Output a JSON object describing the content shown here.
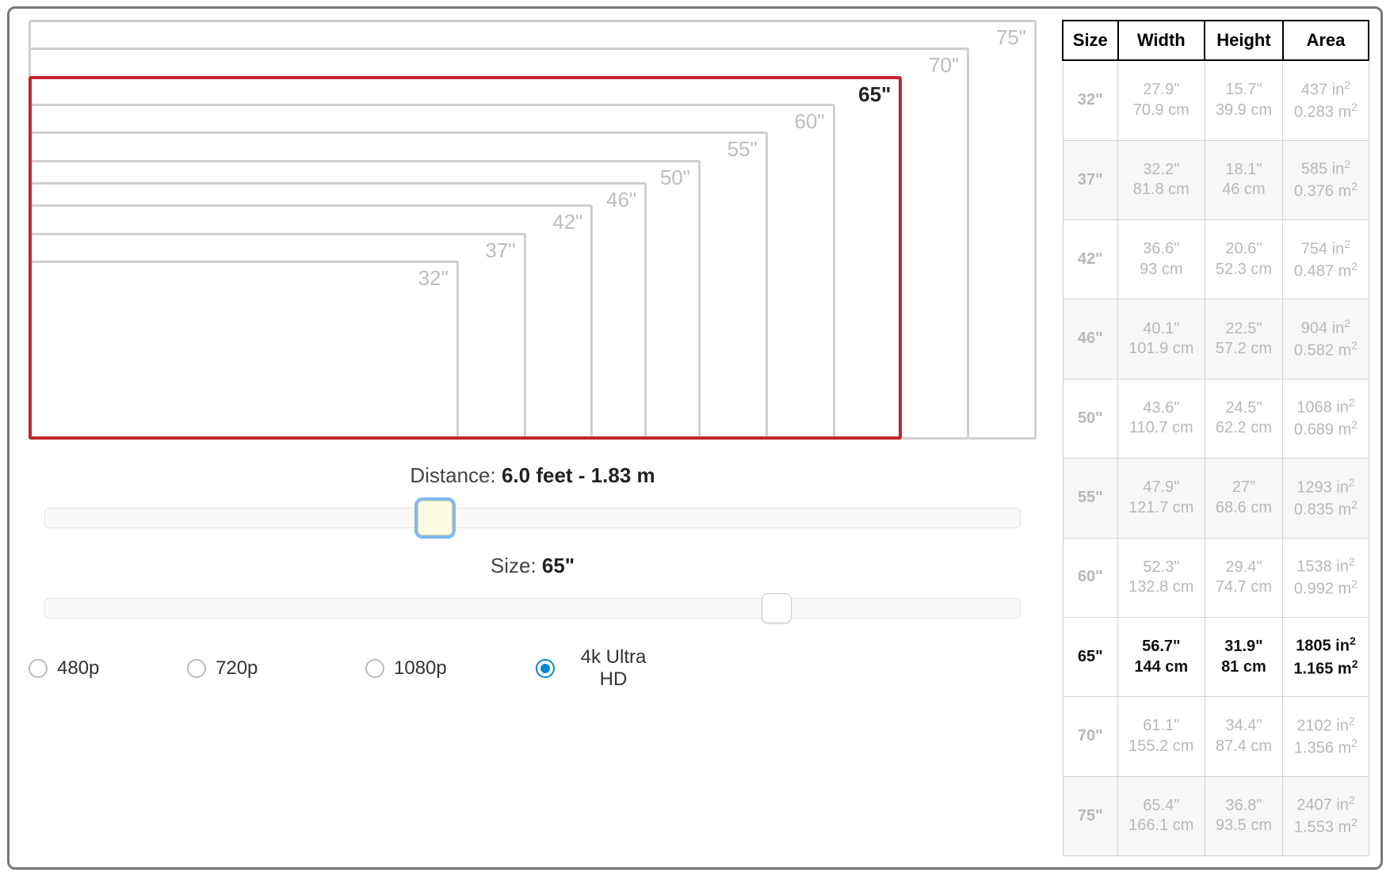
{
  "overlay": {
    "sizes": [
      "32\"",
      "37\"",
      "42\"",
      "46\"",
      "50\"",
      "55\"",
      "60\"",
      "65\"",
      "70\"",
      "75\""
    ],
    "selected_index": 7
  },
  "controls": {
    "distance_label": "Distance: ",
    "distance_value": "6.0 feet - 1.83 m",
    "size_label": "Size: ",
    "size_value": "65\"",
    "distance_slider_pct": 40,
    "size_slider_pct": 75
  },
  "resolutions": [
    {
      "id": "480p",
      "label": "480p",
      "checked": false
    },
    {
      "id": "720p",
      "label": "720p",
      "checked": false
    },
    {
      "id": "1080p",
      "label": "1080p",
      "checked": false
    },
    {
      "id": "4k",
      "label": "4k Ultra HD",
      "checked": true
    }
  ],
  "table": {
    "headers": [
      "Size",
      "Width",
      "Height",
      "Area"
    ],
    "rows": [
      {
        "size": "32\"",
        "width_in": "27.9\"",
        "width_cm": "70.9 cm",
        "height_in": "15.7\"",
        "height_cm": "39.9 cm",
        "area_in": "437 in",
        "area_m": "0.283 m",
        "selected": false
      },
      {
        "size": "37\"",
        "width_in": "32.2\"",
        "width_cm": "81.8 cm",
        "height_in": "18.1\"",
        "height_cm": "46 cm",
        "area_in": "585 in",
        "area_m": "0.376 m",
        "selected": false
      },
      {
        "size": "42\"",
        "width_in": "36.6\"",
        "width_cm": "93 cm",
        "height_in": "20.6\"",
        "height_cm": "52.3 cm",
        "area_in": "754 in",
        "area_m": "0.487 m",
        "selected": false
      },
      {
        "size": "46\"",
        "width_in": "40.1\"",
        "width_cm": "101.9 cm",
        "height_in": "22.5\"",
        "height_cm": "57.2 cm",
        "area_in": "904 in",
        "area_m": "0.582 m",
        "selected": false
      },
      {
        "size": "50\"",
        "width_in": "43.6\"",
        "width_cm": "110.7 cm",
        "height_in": "24.5\"",
        "height_cm": "62.2 cm",
        "area_in": "1068 in",
        "area_m": "0.689 m",
        "selected": false
      },
      {
        "size": "55\"",
        "width_in": "47.9\"",
        "width_cm": "121.7 cm",
        "height_in": "27\"",
        "height_cm": "68.6 cm",
        "area_in": "1293 in",
        "area_m": "0.835 m",
        "selected": false
      },
      {
        "size": "60\"",
        "width_in": "52.3\"",
        "width_cm": "132.8 cm",
        "height_in": "29.4\"",
        "height_cm": "74.7 cm",
        "area_in": "1538 in",
        "area_m": "0.992 m",
        "selected": false
      },
      {
        "size": "65\"",
        "width_in": "56.7\"",
        "width_cm": "144 cm",
        "height_in": "31.9\"",
        "height_cm": "81 cm",
        "area_in": "1805 in",
        "area_m": "1.165 m",
        "selected": true
      },
      {
        "size": "70\"",
        "width_in": "61.1\"",
        "width_cm": "155.2 cm",
        "height_in": "34.4\"",
        "height_cm": "87.4 cm",
        "area_in": "2102 in",
        "area_m": "1.356 m",
        "selected": false
      },
      {
        "size": "75\"",
        "width_in": "65.4\"",
        "width_cm": "166.1 cm",
        "height_in": "36.8\"",
        "height_cm": "93.5 cm",
        "area_in": "2407 in",
        "area_m": "1.553 m",
        "selected": false
      }
    ]
  }
}
